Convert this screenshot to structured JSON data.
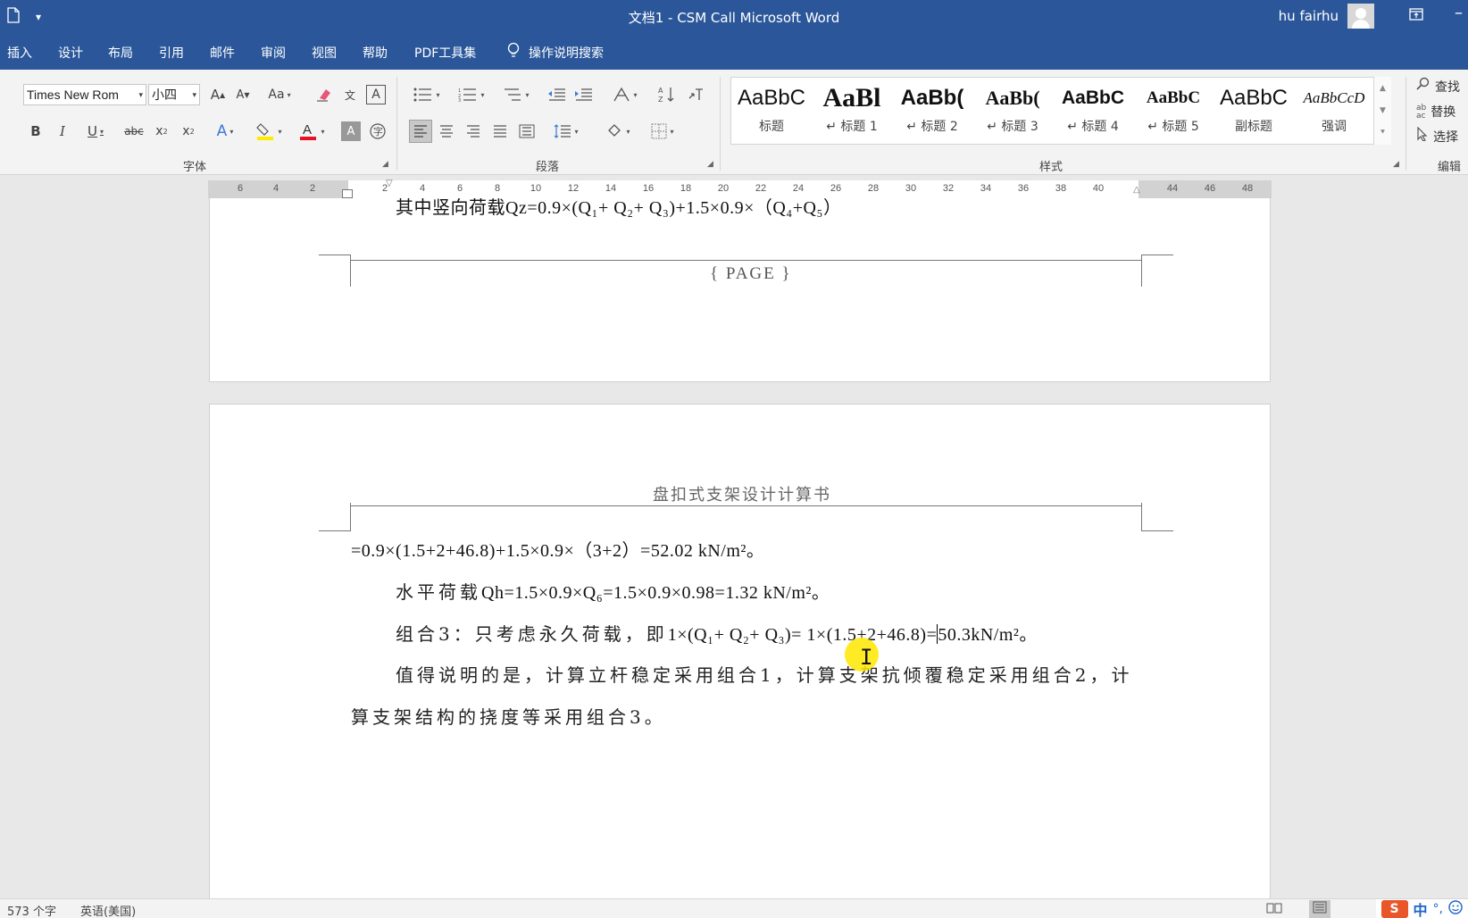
{
  "titlebar": {
    "title": "文档1  -  CSM Call Microsoft Word",
    "user": "hu fairhu"
  },
  "tabs": [
    "插入",
    "设计",
    "布局",
    "引用",
    "邮件",
    "审阅",
    "视图",
    "帮助",
    "PDF工具集"
  ],
  "tell_me": "操作说明搜索",
  "ribbon": {
    "font_name": "Times New Rom",
    "font_size": "小四",
    "groups": {
      "font": "字体",
      "paragraph": "段落",
      "styles": "样式",
      "editing": "编辑"
    },
    "styles": [
      {
        "preview": "AaBbC",
        "name": "标题"
      },
      {
        "preview": "AaBl",
        "name": "↵ 标题 1"
      },
      {
        "preview": "AaBb(",
        "name": "↵ 标题 2"
      },
      {
        "preview": "AaBb(",
        "name": "↵ 标题 3"
      },
      {
        "preview": "AaBbC",
        "name": "↵ 标题 4"
      },
      {
        "preview": "AaBbC",
        "name": "↵ 标题 5"
      },
      {
        "preview": "AaBbC",
        "name": "副标题"
      },
      {
        "preview": "AaBbCcD",
        "name": "强调"
      }
    ],
    "editing": {
      "find": "查找",
      "replace": "替换",
      "select": "选择"
    }
  },
  "ruler": {
    "labels": [
      "6",
      "4",
      "2",
      "2",
      "4",
      "6",
      "8",
      "10",
      "12",
      "14",
      "16",
      "18",
      "20",
      "22",
      "24",
      "26",
      "28",
      "30",
      "32",
      "34",
      "36",
      "38",
      "40",
      "44",
      "46",
      "48"
    ]
  },
  "page1": {
    "top_line": "其中竖向荷载Qz=0.9×(Q₁+ Q₂+ Q₃)+1.5×0.9×（Q₄+Q₅）",
    "footer_field": "{ PAGE }"
  },
  "page2": {
    "header_title": "盘扣式支架设计计算书",
    "line1": "=0.9×(1.5+2+46.8)+1.5×0.9×（3+2）=52.02 kN/m²。",
    "line2_zh": "水平荷载",
    "line2_formula": "Qh=1.5×0.9×Q₆=1.5×0.9×0.98=1.32 kN/m²。",
    "line3_zh": "组合3：只考虑永久荷载，即",
    "line3_formula_a": "1×(Q₁+ Q₂+ Q₃)= 1×(1.5+2+46.8)=",
    "line3_formula_b": "50.3kN/m²。",
    "line4": "值得说明的是，计算立杆稳定采用组合1，计算支架抗倾覆稳定采用组合2，计",
    "line5": "算支架结构的挠度等采用组合3。"
  },
  "statusbar": {
    "word_count": "573 个字",
    "language": "英语(美国)",
    "ime_logo": "S",
    "ime_mode": "中"
  }
}
